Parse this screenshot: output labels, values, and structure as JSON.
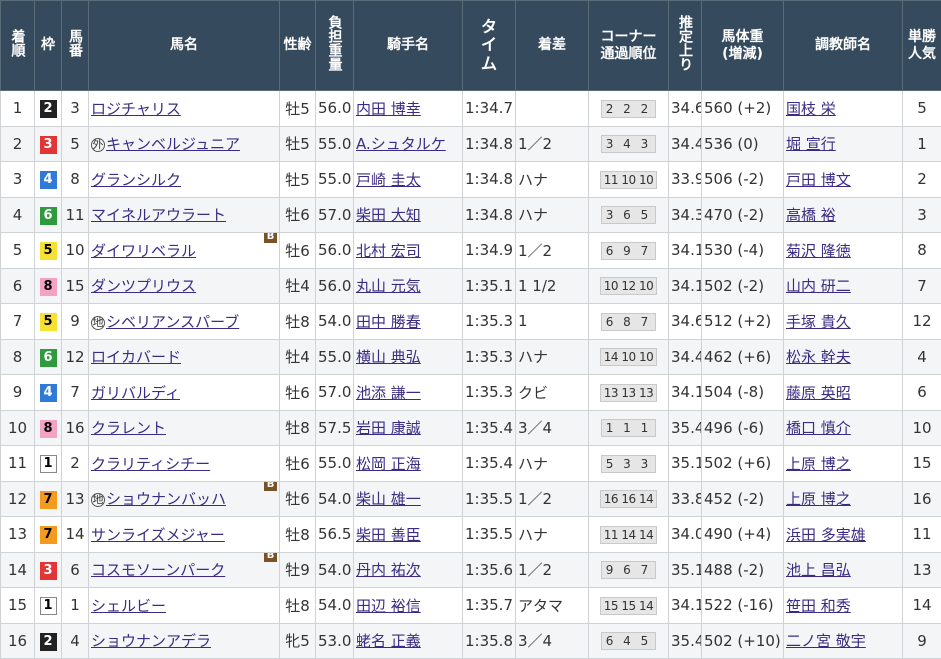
{
  "headers": {
    "rank": "着順",
    "frame": "枠",
    "horse_no": "馬番",
    "horse_name": "馬名",
    "sex_age": "性齢",
    "weight_carried": "負担重量",
    "jockey": "騎手名",
    "time": "タイム",
    "margin": "着差",
    "corner": "コーナー通過順位",
    "last3f": "推定上り",
    "body_weight": "馬体重(増減)",
    "trainer": "調教師名",
    "popularity": "単勝人気"
  },
  "rows": [
    {
      "rank": "1",
      "frame": "2",
      "no": "3",
      "mark": "",
      "name": "ロジチャリス",
      "blinker": "",
      "sex_age": "牡5",
      "kg": "56.0",
      "jockey": "内田 博幸",
      "time": "1:34.7",
      "margin": "",
      "corner": "2 2 2",
      "last3f": "34.6",
      "body": "560 (+2)",
      "trainer": "国枝 栄",
      "pop": "5"
    },
    {
      "rank": "2",
      "frame": "3",
      "no": "5",
      "mark": "外",
      "name": "キャンベルジュニア",
      "blinker": "",
      "sex_age": "牡5",
      "kg": "55.0",
      "jockey": "A.シュタルケ",
      "time": "1:34.8",
      "margin": "1／2",
      "corner": "3 4 3",
      "last3f": "34.4",
      "body": "536 (0)",
      "trainer": "堀 宣行",
      "pop": "1"
    },
    {
      "rank": "3",
      "frame": "4",
      "no": "8",
      "mark": "",
      "name": "グランシルク",
      "blinker": "",
      "sex_age": "牡5",
      "kg": "55.0",
      "jockey": "戸崎 圭太",
      "time": "1:34.8",
      "margin": "ハナ",
      "corner": "11 10 10",
      "last3f": "33.9",
      "body": "506 (-2)",
      "trainer": "戸田 博文",
      "pop": "2"
    },
    {
      "rank": "4",
      "frame": "6",
      "no": "11",
      "mark": "",
      "name": "マイネルアウラート",
      "blinker": "",
      "sex_age": "牡6",
      "kg": "57.0",
      "jockey": "柴田 大知",
      "time": "1:34.8",
      "margin": "ハナ",
      "corner": "3 6 5",
      "last3f": "34.3",
      "body": "470 (-2)",
      "trainer": "高橋 裕",
      "pop": "3"
    },
    {
      "rank": "5",
      "frame": "5",
      "no": "10",
      "mark": "",
      "name": "ダイワリベラル",
      "blinker": "B",
      "sex_age": "牡6",
      "kg": "56.0",
      "jockey": "北村 宏司",
      "time": "1:34.9",
      "margin": "1／2",
      "corner": "6 9 7",
      "last3f": "34.1",
      "body": "530 (-4)",
      "trainer": "菊沢 隆徳",
      "pop": "8"
    },
    {
      "rank": "6",
      "frame": "8",
      "no": "15",
      "mark": "",
      "name": "ダンツプリウス",
      "blinker": "",
      "sex_age": "牡4",
      "kg": "56.0",
      "jockey": "丸山 元気",
      "time": "1:35.1",
      "margin": "1 1/2",
      "corner": "10 12 10",
      "last3f": "34.1",
      "body": "502 (-2)",
      "trainer": "山内 研二",
      "pop": "7"
    },
    {
      "rank": "7",
      "frame": "5",
      "no": "9",
      "mark": "地",
      "name": "シベリアンスパーブ",
      "blinker": "",
      "sex_age": "牡8",
      "kg": "54.0",
      "jockey": "田中 勝春",
      "time": "1:35.3",
      "margin": "1",
      "corner": "6 8 7",
      "last3f": "34.6",
      "body": "512 (+2)",
      "trainer": "手塚 貴久",
      "pop": "12"
    },
    {
      "rank": "8",
      "frame": "6",
      "no": "12",
      "mark": "",
      "name": "ロイカバード",
      "blinker": "",
      "sex_age": "牡4",
      "kg": "55.0",
      "jockey": "横山 典弘",
      "time": "1:35.3",
      "margin": "ハナ",
      "corner": "14 10 10",
      "last3f": "34.4",
      "body": "462 (+6)",
      "trainer": "松永 幹夫",
      "pop": "4"
    },
    {
      "rank": "9",
      "frame": "4",
      "no": "7",
      "mark": "",
      "name": "ガリバルディ",
      "blinker": "",
      "sex_age": "牡6",
      "kg": "57.0",
      "jockey": "池添 謙一",
      "time": "1:35.3",
      "margin": "クビ",
      "corner": "13 13 13",
      "last3f": "34.1",
      "body": "504 (-8)",
      "trainer": "藤原 英昭",
      "pop": "6"
    },
    {
      "rank": "10",
      "frame": "8",
      "no": "16",
      "mark": "",
      "name": "クラレント",
      "blinker": "",
      "sex_age": "牡8",
      "kg": "57.5",
      "jockey": "岩田 康誠",
      "time": "1:35.4",
      "margin": "3／4",
      "corner": "1 1 1",
      "last3f": "35.4",
      "body": "496 (-6)",
      "trainer": "橋口 慎介",
      "pop": "10"
    },
    {
      "rank": "11",
      "frame": "1",
      "no": "2",
      "mark": "",
      "name": "クラリティシチー",
      "blinker": "",
      "sex_age": "牡6",
      "kg": "55.0",
      "jockey": "松岡 正海",
      "time": "1:35.4",
      "margin": "ハナ",
      "corner": "5 3 3",
      "last3f": "35.1",
      "body": "502 (+6)",
      "trainer": "上原 博之",
      "pop": "15"
    },
    {
      "rank": "12",
      "frame": "7",
      "no": "13",
      "mark": "地",
      "name": "ショウナンバッハ",
      "blinker": "B",
      "sex_age": "牡6",
      "kg": "54.0",
      "jockey": "柴山 雄一",
      "time": "1:35.5",
      "margin": "1／2",
      "corner": "16 16 14",
      "last3f": "33.8",
      "body": "452 (-2)",
      "trainer": "上原 博之",
      "pop": "16"
    },
    {
      "rank": "13",
      "frame": "7",
      "no": "14",
      "mark": "",
      "name": "サンライズメジャー",
      "blinker": "",
      "sex_age": "牡8",
      "kg": "56.5",
      "jockey": "柴田 善臣",
      "time": "1:35.5",
      "margin": "ハナ",
      "corner": "11 14 14",
      "last3f": "34.0",
      "body": "490 (+4)",
      "trainer": "浜田 多実雄",
      "pop": "11"
    },
    {
      "rank": "14",
      "frame": "3",
      "no": "6",
      "mark": "",
      "name": "コスモソーンパーク",
      "blinker": "B",
      "sex_age": "牡9",
      "kg": "54.0",
      "jockey": "丹内 祐次",
      "time": "1:35.6",
      "margin": "1／2",
      "corner": "9 6 7",
      "last3f": "35.1",
      "body": "488 (-2)",
      "trainer": "池上 昌弘",
      "pop": "13"
    },
    {
      "rank": "15",
      "frame": "1",
      "no": "1",
      "mark": "",
      "name": "シェルビー",
      "blinker": "",
      "sex_age": "牡8",
      "kg": "54.0",
      "jockey": "田辺 裕信",
      "time": "1:35.7",
      "margin": "アタマ",
      "corner": "15 15 14",
      "last3f": "34.1",
      "body": "522 (-16)",
      "trainer": "笹田 和秀",
      "pop": "14"
    },
    {
      "rank": "16",
      "frame": "2",
      "no": "4",
      "mark": "",
      "name": "ショウナンアデラ",
      "blinker": "",
      "sex_age": "牝5",
      "kg": "53.0",
      "jockey": "蛯名 正義",
      "time": "1:35.8",
      "margin": "3／4",
      "corner": "6 4 5",
      "last3f": "35.4",
      "body": "502 (+10)",
      "trainer": "二ノ宮 敬宇",
      "pop": "9"
    }
  ]
}
